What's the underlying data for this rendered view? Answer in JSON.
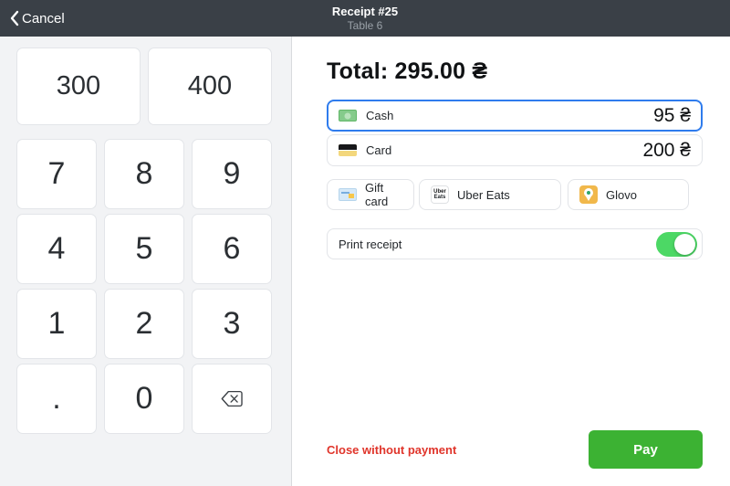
{
  "topbar": {
    "cancel": "Cancel",
    "back_icon": "back-chevron-icon",
    "title": "Receipt #25",
    "subtitle": "Table 6"
  },
  "numpad": {
    "quick": [
      "300",
      "400"
    ],
    "keys": [
      "7",
      "8",
      "9",
      "4",
      "5",
      "6",
      "1",
      "2",
      "3",
      ".",
      "0"
    ],
    "backspace_icon": "backspace-left-icon"
  },
  "payment": {
    "total": "Total: 295.00 ₴",
    "methods": [
      {
        "label": "Cash",
        "amount": "95 ₴",
        "icon": "cash-banknote-icon",
        "selected": true
      },
      {
        "label": "Card",
        "amount": "200 ₴",
        "icon": "credit-card-icon",
        "selected": false
      }
    ],
    "alt_methods": [
      {
        "label": "Gift card",
        "icon": "gift-card-icon"
      },
      {
        "label": "Uber Eats",
        "icon": "uber-eats-logo-icon"
      },
      {
        "label": "Glovo",
        "icon": "glovo-logo-icon"
      }
    ],
    "uber_eats_logo": {
      "top": "Uber",
      "bottom": "Eats"
    },
    "print_receipt": {
      "label": "Print receipt",
      "enabled": true
    },
    "close_without_payment": "Close without payment",
    "pay": "Pay"
  },
  "colors": {
    "topbar_bg": "#3a4047",
    "panel_bg": "#f2f3f5",
    "selected_border_blue": "#2f7ced",
    "toggle_green": "#4cd865",
    "pay_green": "#3cb233",
    "danger_red": "#e0352b"
  }
}
